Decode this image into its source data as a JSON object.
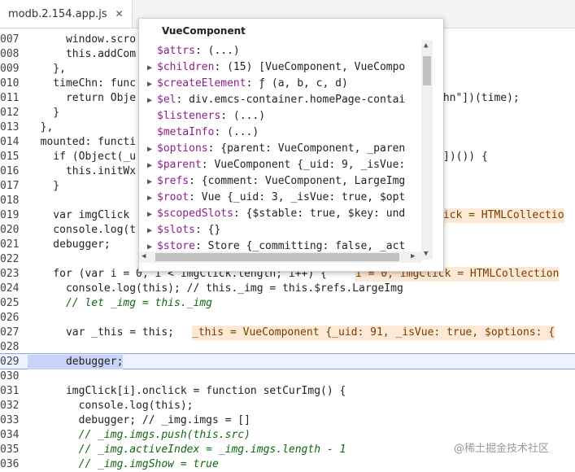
{
  "tab": {
    "label": "modb.2.154.app.js",
    "close": "✕"
  },
  "code_lines": [
    {
      "n": "007",
      "t": "      window.scro"
    },
    {
      "n": "008",
      "t": "      this.addCom"
    },
    {
      "n": "009",
      "t": "    },"
    },
    {
      "n": "010",
      "t": "    timeChn: func"
    },
    {
      "n": "011",
      "t": "      return Obje"
    },
    {
      "n": "012",
      "t": "    }"
    },
    {
      "n": "013",
      "t": "  },"
    },
    {
      "n": "014",
      "t": "  mounted: functi"
    },
    {
      "n": "015",
      "t": "    if (Object(_u"
    },
    {
      "n": "016",
      "t": "      this.initWx"
    },
    {
      "n": "017",
      "t": "    }"
    },
    {
      "n": "018",
      "t": ""
    },
    {
      "n": "019",
      "t": "    var imgClick"
    },
    {
      "n": "020",
      "t": "    console.log(t"
    },
    {
      "n": "021",
      "t": "    debugger;"
    },
    {
      "n": "022",
      "t": ""
    },
    {
      "n": "023",
      "t": "    for (var i = 0, i < imgClick.length; i++) {"
    },
    {
      "n": "024",
      "t": "      console.log(this); // this._img = this.$refs.LargeImg"
    },
    {
      "n": "025",
      "t": "      // let _img = this._img"
    },
    {
      "n": "026",
      "t": ""
    },
    {
      "n": "027",
      "t": "      var _this = this;"
    },
    {
      "n": "028",
      "t": ""
    },
    {
      "n": "029",
      "t": "      debugger;"
    },
    {
      "n": "030",
      "t": ""
    },
    {
      "n": "031",
      "t": "      imgClick[i].onclick = function setCurImg() {"
    },
    {
      "n": "032",
      "t": "        console.log(this);"
    },
    {
      "n": "033",
      "t": "        debugger; // _img.imgs = []"
    },
    {
      "n": "034",
      "t": "        // _img.imgs.push(this.src)"
    },
    {
      "n": "035",
      "t": "        // _img.activeIndex = _img.imgs.length - 1"
    },
    {
      "n": "036",
      "t": "        // _img.imgShow = true"
    }
  ],
  "right_fragments": {
    "line011": "Chn\"])(time);",
    "line015": "])()) {",
    "line019": "lick = HTMLCollectio",
    "line023": "i = 0, imgClick = HTMLCollection",
    "line027": "_this = VueComponent {_uid: 91, _isVue: true, $options: {"
  },
  "popup": {
    "title": "VueComponent",
    "rows": [
      {
        "arrow": false,
        "key": "$attrs",
        "val": ": (...)"
      },
      {
        "arrow": true,
        "key": "$children",
        "val": ": (15) [VueComponent, VueCompo"
      },
      {
        "arrow": true,
        "key": "$createElement",
        "val": ": ƒ (a, b, c, d)"
      },
      {
        "arrow": true,
        "key": "$el",
        "val": ": div.emcs-container.homePage-contai"
      },
      {
        "arrow": false,
        "key": "$listeners",
        "val": ": (...)"
      },
      {
        "arrow": false,
        "key": "$metaInfo",
        "val": ": (...)"
      },
      {
        "arrow": true,
        "key": "$options",
        "val": ": {parent: VueComponent, _paren"
      },
      {
        "arrow": true,
        "key": "$parent",
        "val": ": VueComponent {_uid: 9, _isVue:"
      },
      {
        "arrow": true,
        "key": "$refs",
        "val": ": {comment: VueComponent, LargeImg"
      },
      {
        "arrow": true,
        "key": "$root",
        "val": ": Vue {_uid: 3, _isVue: true, $opt"
      },
      {
        "arrow": true,
        "key": "$scopedSlots",
        "val": ": {$stable: true, $key: und"
      },
      {
        "arrow": true,
        "key": "$slots",
        "val": ": {}"
      },
      {
        "arrow": true,
        "key": "$store",
        "val": ": Store {_committing: false, _act"
      }
    ]
  },
  "watermark": "@稀土掘金技术社区"
}
